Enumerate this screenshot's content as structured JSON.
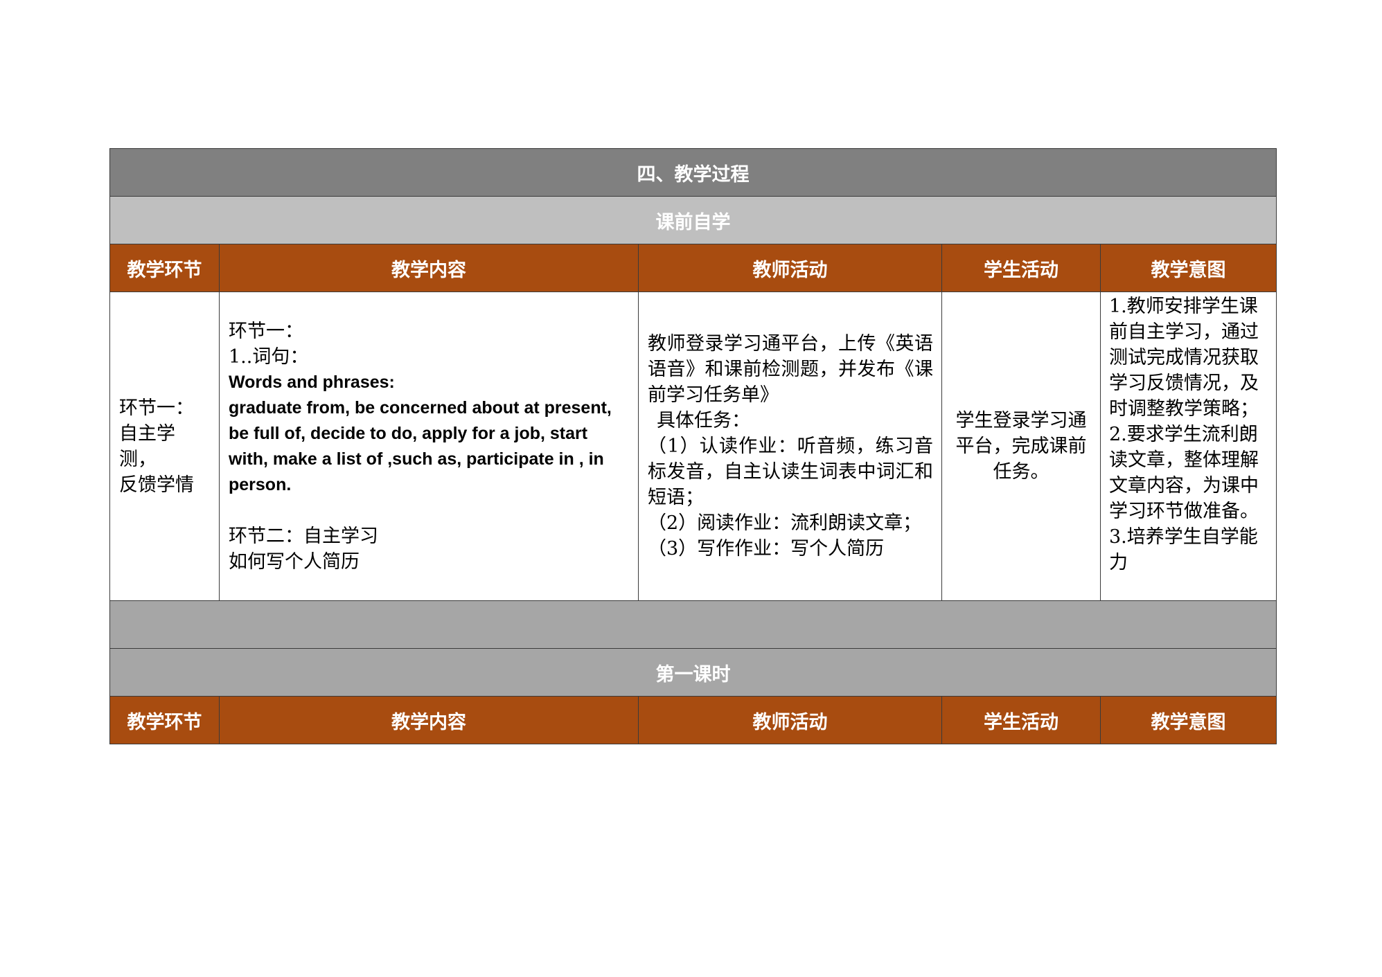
{
  "sections": {
    "process_title": "四、教学过程",
    "pre_class_title": "课前自学",
    "first_lesson_title": "第一课时"
  },
  "columns": [
    "教学环节",
    "教学内容",
    "教师活动",
    "学生活动",
    "教学意图"
  ],
  "pre_class_row": {
    "stage": [
      "环节一：",
      "自主学测，",
      "反馈学情"
    ],
    "content": {
      "part1_label": "环节一：",
      "part1_item": "1..词句：",
      "words_heading": "Words and phrases:",
      "words_text": "graduate from, be concerned about at present, be full of, decide to do, apply for a job, start with, make a list of ,such as, participate in , in person.",
      "part2_label": "环节二：自主学习",
      "part2_item": "如何写个人简历"
    },
    "teacher": [
      "教师登录学习通平台，上传《英语语音》和课前检测题，并发布《课前学习任务单》",
      "具体任务：",
      "（1）认读作业：听音频，练习音标发音，自主认读生词表中词汇和短语；",
      "（2）阅读作业：流利朗读文章；",
      "（3）写作作业：写个人简历"
    ],
    "student": "学生登录学习通平台，完成课前任务。",
    "intent": [
      "1.教师安排学生课前自主学习，通过测试完成情况获取学习反馈情况，及时调整教学策略；",
      "2.要求学生流利朗读文章，整体理解文章内容，为课中学习环节做准备。",
      "3.培养学生自学能力"
    ]
  }
}
